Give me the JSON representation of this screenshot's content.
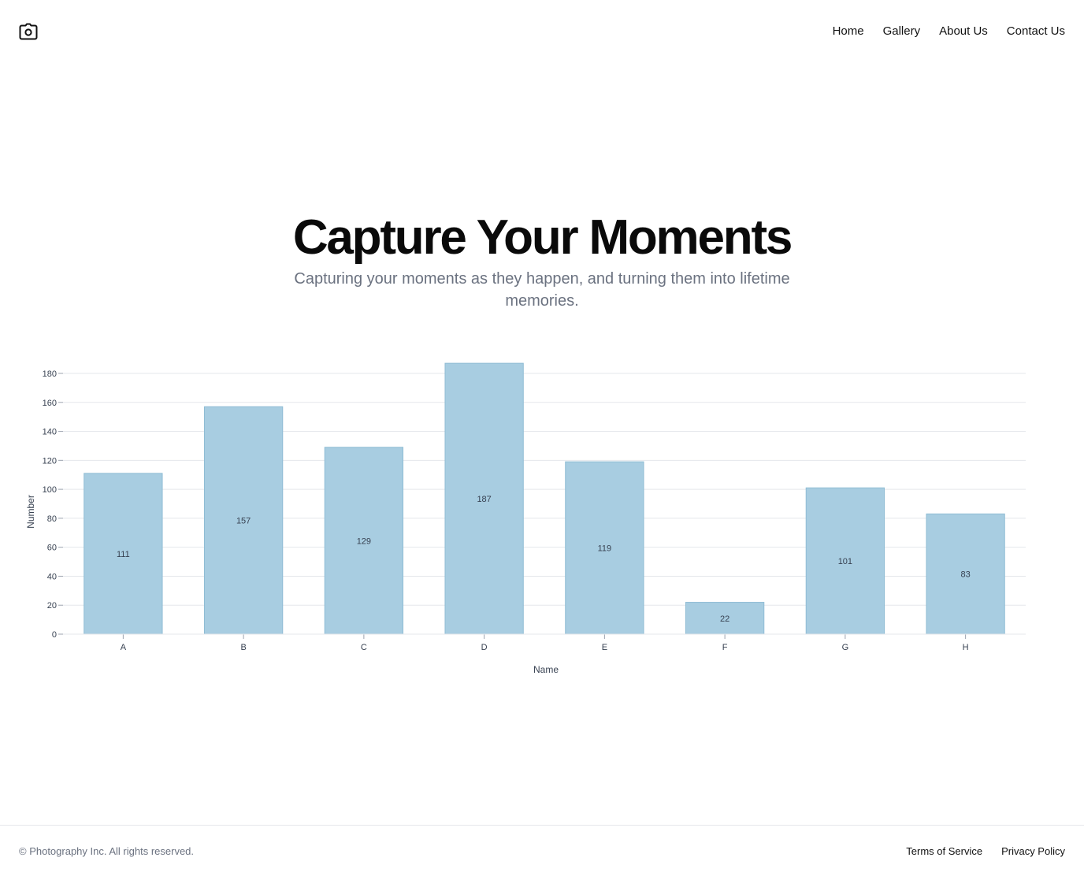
{
  "header": {
    "logo_icon": "camera-icon",
    "nav": [
      {
        "label": "Home"
      },
      {
        "label": "Gallery"
      },
      {
        "label": "About Us"
      },
      {
        "label": "Contact Us"
      }
    ]
  },
  "hero": {
    "title": "Capture Your Moments",
    "subtitle": "Capturing your moments as they happen, and turning them into lifetime memories."
  },
  "chart_data": {
    "type": "bar",
    "categories": [
      "A",
      "B",
      "C",
      "D",
      "E",
      "F",
      "G",
      "H"
    ],
    "values": [
      111,
      157,
      129,
      187,
      119,
      22,
      101,
      83
    ],
    "xlabel": "Name",
    "ylabel": "Number",
    "ylim": [
      0,
      180
    ],
    "yticks": [
      0,
      20,
      40,
      60,
      80,
      100,
      120,
      140,
      160,
      180
    ],
    "grid": true,
    "bar_color": "#a8cde1",
    "bar_stroke": "#8fbcd4",
    "grid_color": "#e5e7eb"
  },
  "footer": {
    "copyright": "© Photography Inc. All rights reserved.",
    "links": [
      {
        "label": "Terms of Service"
      },
      {
        "label": "Privacy Policy"
      }
    ]
  }
}
